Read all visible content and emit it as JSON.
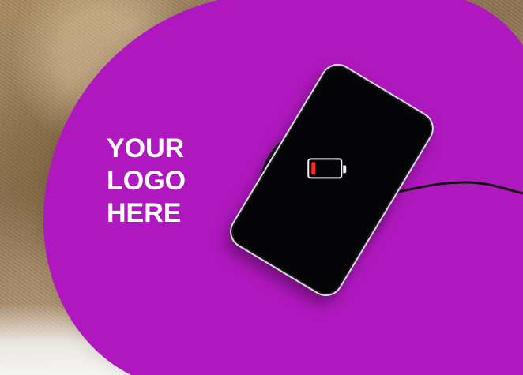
{
  "logo": {
    "lines": [
      "YOUR",
      "LOGO",
      "HERE"
    ]
  },
  "phone": {
    "battery_level": 0.14,
    "battery_color": "#ff2727"
  },
  "colors": {
    "panel": "#b018bf",
    "text": "#ffffff"
  },
  "icons": {
    "battery": "battery-low-icon",
    "phone": "smartphone-icon",
    "charger": "wireless-charger-icon"
  }
}
